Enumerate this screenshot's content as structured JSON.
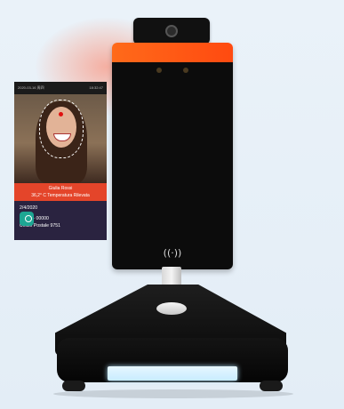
{
  "image": {
    "description_kind": "product photo of a facial recognition temperature kiosk on stand"
  },
  "screen": {
    "status_left": "2020-03-16 周四",
    "status_right": "18:32:47",
    "person_name": "Giulia Rossi",
    "temperature_text": "36,2° C Temperatura Rilevata",
    "date_text": "2/4/2020",
    "location_line1": "Roma - 00000",
    "location_line2": "Ufficio Postale 9751"
  },
  "device": {
    "nfc_symbol": "((·))",
    "accent_color": "#ff5a14",
    "name_bar_color": "#e4452a",
    "info_panel_color": "#2a2340",
    "ok_indicator_color": "#1da693"
  },
  "icons": {
    "camera": "camera-icon",
    "nfc": "nfc-icon",
    "status": "check-circle-icon"
  }
}
